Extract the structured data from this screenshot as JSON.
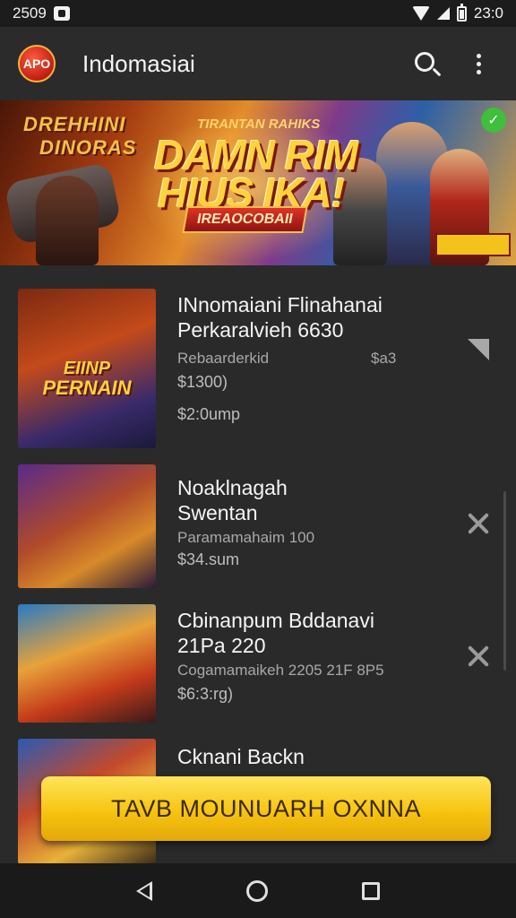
{
  "status_bar": {
    "time_left": "2509",
    "time_right": "23:0"
  },
  "app_bar": {
    "logo_text": "APO",
    "title": "Indomasiai"
  },
  "banner": {
    "small_title_line1": "DREHHINI",
    "small_title_line2": "DINORAS",
    "subtitle": "TIRANTAN RAHIKS",
    "headline_line1": "DAMN RIM",
    "headline_line2": "HIUS IKA!",
    "tag": "IREAOCOBAII"
  },
  "items": [
    {
      "thumb_text": "PERNAIN",
      "thumb_top": "EIINP",
      "title_line1": "INnomaiani Flinahanai",
      "title_line2": "Perkaralvieh 6630",
      "meta": "Rebaarderkid",
      "meta_right": "$a3",
      "price1": "$1300)",
      "price2": "$2:0ump",
      "action": "arrow"
    },
    {
      "thumb_text": "",
      "title_line1": "Noaklnagah",
      "title_line2": "Swentan",
      "meta": "Paramamahaim 100",
      "price1": "$34.sum",
      "action": "close"
    },
    {
      "thumb_text": "",
      "title_line1": "Cbinanpum Bddanavi",
      "title_line2": "21Pa 220",
      "meta": "Cogamamaikeh 2205 21F 8P5",
      "price1": "$6:3:rg)",
      "action": "close"
    },
    {
      "thumb_text": "",
      "title_line1": "Cknani Backn",
      "title_line2": "",
      "meta": "",
      "price1": "",
      "action": ""
    }
  ],
  "cta": {
    "label": "TAVB MOUNUARH OXNNA"
  }
}
